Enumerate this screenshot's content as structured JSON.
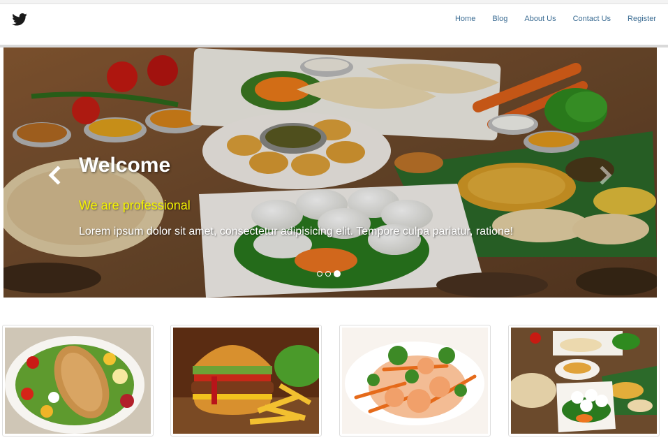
{
  "navbar": {
    "logo_icon": "twitter-bird-icon",
    "items": [
      {
        "label": "Home"
      },
      {
        "label": "Blog"
      },
      {
        "label": "About Us"
      },
      {
        "label": "Contact Us"
      },
      {
        "label": "Register"
      }
    ],
    "link_color": "#3b6c93"
  },
  "carousel": {
    "heading": "Welcome",
    "subheading": "We are professional",
    "text": "Lorem ipsum dolor sit amet, consectetur adipisicing elit. Tempore culpa pariatur, ratione!",
    "prev_icon": "chevron-left-icon",
    "next_icon": "chevron-right-icon",
    "slide_count": 3,
    "active_slide": 3,
    "subheading_color": "#f4f400"
  },
  "thumbnails": [
    {
      "subject": "grilled-chicken-salad-image"
    },
    {
      "subject": "burger-and-fries-image"
    },
    {
      "subject": "shrimp-stir-fry-image"
    },
    {
      "subject": "indian-food-spread-image"
    }
  ]
}
